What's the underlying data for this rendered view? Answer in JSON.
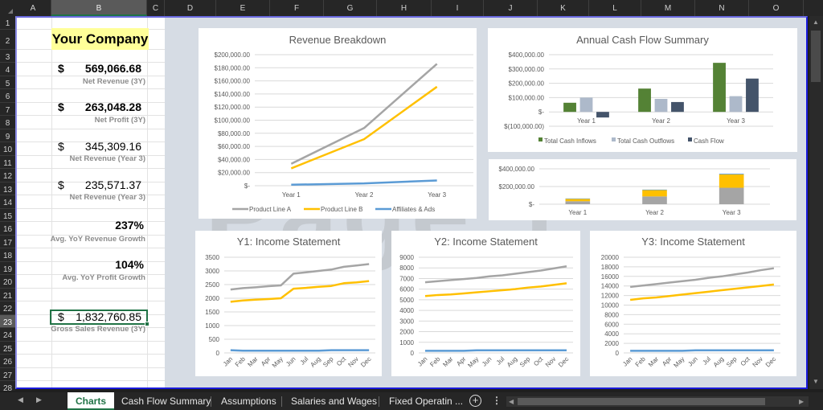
{
  "columns": [
    {
      "label": "A",
      "selected": false
    },
    {
      "label": "B",
      "selected": true
    },
    {
      "label": "C",
      "selected": false
    },
    {
      "label": "D",
      "selected": false
    },
    {
      "label": "E",
      "selected": false
    },
    {
      "label": "F",
      "selected": false
    },
    {
      "label": "G",
      "selected": false
    },
    {
      "label": "H",
      "selected": false
    },
    {
      "label": "I",
      "selected": false
    },
    {
      "label": "J",
      "selected": false
    },
    {
      "label": "K",
      "selected": false
    },
    {
      "label": "L",
      "selected": false
    },
    {
      "label": "M",
      "selected": false
    },
    {
      "label": "N",
      "selected": false
    },
    {
      "label": "O",
      "selected": false
    }
  ],
  "rows": [
    "1",
    "2",
    "3",
    "4",
    "5",
    "6",
    "7",
    "8",
    "9",
    "10",
    "11",
    "12",
    "13",
    "14",
    "15",
    "16",
    "17",
    "18",
    "19",
    "20",
    "21",
    "22",
    "23",
    "24",
    "25",
    "26",
    "27",
    "28"
  ],
  "selected_row": "23",
  "company_name": "Your Company",
  "watermark": "Page 1",
  "kpis": [
    {
      "currency": "$",
      "value": "569,066.68",
      "label": "Net Revenue (3Y)",
      "bold": true
    },
    {
      "currency": "$",
      "value": "263,048.28",
      "label": "Net Profit (3Y)",
      "bold": true
    },
    {
      "currency": "$",
      "value": "345,309.16",
      "label": "Net Revenue (Year 3)",
      "bold": false
    },
    {
      "currency": "$",
      "value": "235,571.37",
      "label": "Net Revenue (Year 3)",
      "bold": false
    }
  ],
  "growth": [
    {
      "value": "237%",
      "label": "Avg. YoY Revenue Growth"
    },
    {
      "value": "104%",
      "label": "Avg. YoY Profit Growth"
    }
  ],
  "gross": {
    "currency": "$",
    "value": "1,832,760.85",
    "label": "Gross Sales Revenue (3Y)"
  },
  "colors": {
    "gray": "#a5a5a5",
    "yellow": "#ffc000",
    "blue": "#5b9bd5",
    "green": "#548235",
    "light_blue_gray": "#adb9ca",
    "navy": "#44546a",
    "excel_green": "#217346"
  },
  "chart_data": [
    {
      "id": "revenue_breakdown",
      "type": "line",
      "title": "Revenue Breakdown",
      "categories": [
        "Year 1",
        "Year 2",
        "Year 3"
      ],
      "ylim": [
        0,
        200000
      ],
      "yticks": [
        0,
        20000,
        40000,
        60000,
        80000,
        100000,
        120000,
        140000,
        160000,
        180000,
        200000
      ],
      "ytick_labels": [
        "$-",
        "$20,000.00",
        "$40,000.00",
        "$60,000.00",
        "$80,000.00",
        "$100,000.00",
        "$120,000.00",
        "$140,000.00",
        "$160,000.00",
        "$180,000.00",
        "$200,000.00"
      ],
      "series": [
        {
          "name": "Product Line A",
          "color": "#a5a5a5",
          "values": [
            33500,
            88000,
            186000
          ]
        },
        {
          "name": "Product Line B",
          "color": "#ffc000",
          "values": [
            26500,
            71000,
            151000
          ]
        },
        {
          "name": "Affiliates & Ads",
          "color": "#5b9bd5",
          "values": [
            1500,
            3500,
            8000
          ]
        }
      ],
      "legend": "bottom",
      "grid": true
    },
    {
      "id": "annual_cash_flow",
      "type": "bar",
      "title": "Annual Cash Flow Summary",
      "categories": [
        "Year 1",
        "Year 2",
        "Year 3"
      ],
      "ylim": [
        -100000,
        400000
      ],
      "yticks": [
        -100000,
        0,
        100000,
        200000,
        300000,
        400000
      ],
      "ytick_labels": [
        "$(100,000.00)",
        "$-",
        "$100,000.00",
        "$200,000.00",
        "$300,000.00",
        "$400,000.00"
      ],
      "series": [
        {
          "name": "Total Cash Inflows",
          "color": "#548235",
          "values": [
            64000,
            163000,
            343000
          ]
        },
        {
          "name": "Total Cash Outflows",
          "color": "#adb9ca",
          "values": [
            100000,
            91000,
            110000
          ]
        },
        {
          "name": "Cash Flow",
          "color": "#44546a",
          "values": [
            -39000,
            69000,
            233000
          ]
        }
      ],
      "legend": "bottom",
      "grid": true
    },
    {
      "id": "stacked_revenue",
      "type": "bar",
      "stacked": true,
      "title": "",
      "categories": [
        "Year 1",
        "Year 2",
        "Year 3"
      ],
      "ylim": [
        0,
        400000
      ],
      "yticks": [
        0,
        200000,
        400000
      ],
      "ytick_labels": [
        "$-",
        "$200,000.00",
        "$400,000.00"
      ],
      "series": [
        {
          "name": "Product Line A",
          "color": "#a5a5a5",
          "values": [
            33500,
            88000,
            186000
          ]
        },
        {
          "name": "Product Line B",
          "color": "#ffc000",
          "values": [
            26500,
            71000,
            151000
          ]
        },
        {
          "name": "Affiliates & Ads",
          "color": "#5b9bd5",
          "values": [
            5000,
            6000,
            8000
          ]
        }
      ],
      "grid": true
    },
    {
      "id": "y1_income",
      "type": "line",
      "title": "Y1: Income Statement",
      "categories": [
        "Jan",
        "Feb",
        "Mar",
        "Apr",
        "May",
        "Jun",
        "Jul",
        "Aug",
        "Sep",
        "Oct",
        "Nov",
        "Dec"
      ],
      "ylim": [
        0,
        3500
      ],
      "yticks": [
        0,
        500,
        1000,
        1500,
        2000,
        2500,
        3000,
        3500
      ],
      "ytick_labels": [
        "0",
        "500",
        "1000",
        "1500",
        "2000",
        "2500",
        "3000",
        "3500"
      ],
      "series": [
        {
          "name": "Product Line A",
          "color": "#a5a5a5",
          "values": [
            2320,
            2370,
            2400,
            2440,
            2470,
            2900,
            2950,
            3000,
            3050,
            3150,
            3200,
            3250
          ]
        },
        {
          "name": "Product Line B",
          "color": "#ffc000",
          "values": [
            1870,
            1920,
            1950,
            1970,
            2000,
            2350,
            2380,
            2420,
            2450,
            2550,
            2580,
            2630
          ]
        },
        {
          "name": "Affiliates & Ads",
          "color": "#5b9bd5",
          "values": [
            100,
            80,
            80,
            80,
            80,
            80,
            80,
            80,
            100,
            100,
            100,
            100
          ]
        }
      ],
      "grid": true
    },
    {
      "id": "y2_income",
      "type": "line",
      "title": "Y2: Income Statement",
      "categories": [
        "Jan",
        "Feb",
        "Mar",
        "Apr",
        "May",
        "Jun",
        "Jul",
        "Aug",
        "Sep",
        "Oct",
        "Nov",
        "Dec"
      ],
      "ylim": [
        0,
        9000
      ],
      "yticks": [
        0,
        1000,
        2000,
        3000,
        4000,
        5000,
        6000,
        7000,
        8000,
        9000
      ],
      "ytick_labels": [
        "0",
        "1000",
        "2000",
        "3000",
        "4000",
        "5000",
        "6000",
        "7000",
        "8000",
        "9000"
      ],
      "series": [
        {
          "name": "Product Line A",
          "color": "#a5a5a5",
          "values": [
            6650,
            6750,
            6850,
            6950,
            7050,
            7200,
            7300,
            7450,
            7600,
            7750,
            7950,
            8150
          ]
        },
        {
          "name": "Product Line B",
          "color": "#ffc000",
          "values": [
            5350,
            5450,
            5500,
            5600,
            5700,
            5800,
            5900,
            6000,
            6150,
            6250,
            6400,
            6550
          ]
        },
        {
          "name": "Affiliates & Ads",
          "color": "#5b9bd5",
          "values": [
            200,
            200,
            200,
            200,
            250,
            250,
            250,
            250,
            250,
            250,
            250,
            250
          ]
        }
      ],
      "grid": true
    },
    {
      "id": "y3_income",
      "type": "line",
      "title": "Y3: Income Statement",
      "categories": [
        "Jan",
        "Feb",
        "Mar",
        "Apr",
        "May",
        "Jun",
        "Jul",
        "Aug",
        "Sep",
        "Oct",
        "Nov",
        "Dec"
      ],
      "ylim": [
        0,
        20000
      ],
      "yticks": [
        0,
        2000,
        4000,
        6000,
        8000,
        10000,
        12000,
        14000,
        16000,
        18000,
        20000
      ],
      "ytick_labels": [
        "0",
        "2000",
        "4000",
        "6000",
        "8000",
        "10000",
        "12000",
        "14000",
        "16000",
        "18000",
        "20000"
      ],
      "series": [
        {
          "name": "Product Line A",
          "color": "#a5a5a5",
          "values": [
            13800,
            14100,
            14400,
            14700,
            15000,
            15300,
            15700,
            16000,
            16400,
            16800,
            17300,
            17700
          ]
        },
        {
          "name": "Product Line B",
          "color": "#ffc000",
          "values": [
            11100,
            11400,
            11600,
            11900,
            12200,
            12500,
            12800,
            13100,
            13400,
            13700,
            14000,
            14300
          ]
        },
        {
          "name": "Affiliates & Ads",
          "color": "#5b9bd5",
          "values": [
            450,
            450,
            450,
            450,
            450,
            550,
            550,
            550,
            550,
            550,
            550,
            550
          ]
        }
      ],
      "grid": true
    }
  ],
  "tabs": [
    {
      "label": "Charts",
      "active": true
    },
    {
      "label": "Cash Flow Summary",
      "active": false
    },
    {
      "label": "Assumptions",
      "active": false
    },
    {
      "label": "Salaries and Wages",
      "active": false
    },
    {
      "label": "Fixed Operatin ...",
      "active": false
    }
  ],
  "tab_icons": {
    "add": "plus-circle-icon",
    "more": "vertical-ellipsis-icon",
    "prev": "triangle-left-icon",
    "next": "triangle-right-icon"
  }
}
